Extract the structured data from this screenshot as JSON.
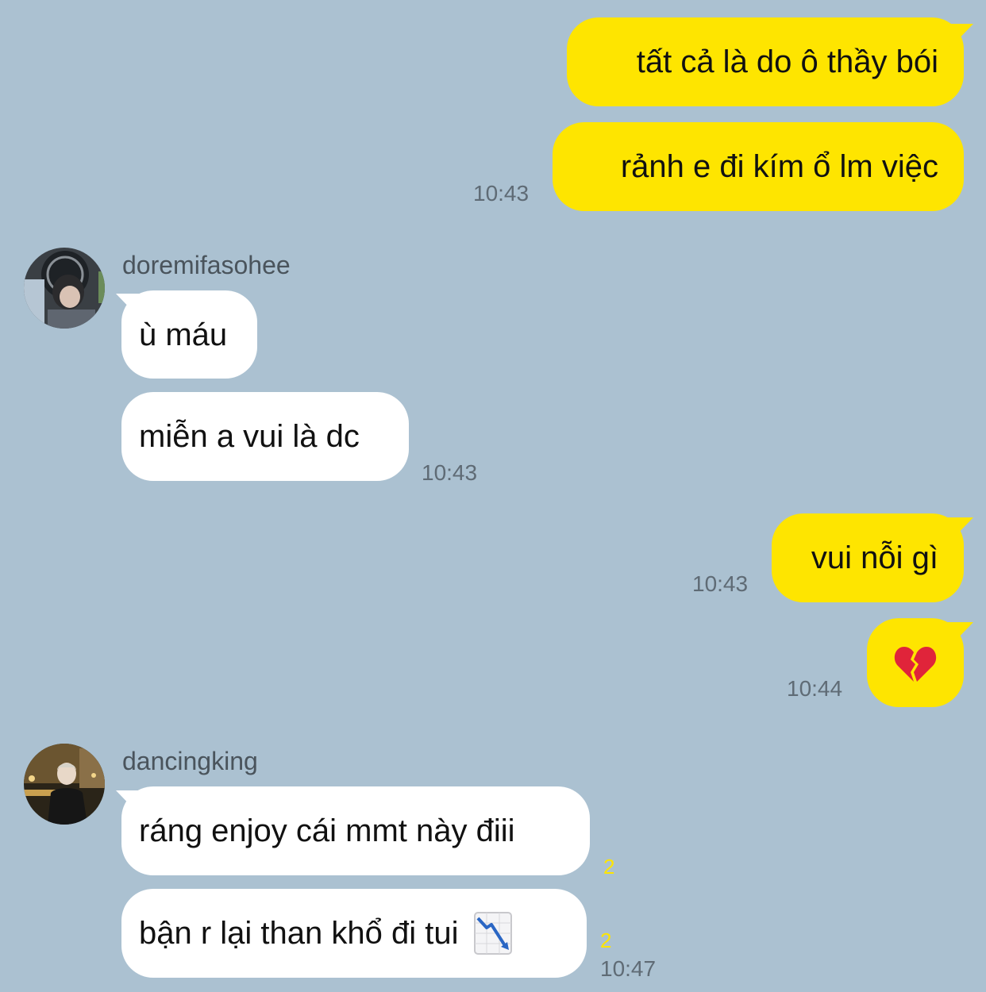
{
  "background_color": "#abc1d1",
  "outgoing_bubble_color": "#fee500",
  "incoming_bubble_color": "#ffffff",
  "messages": [
    {
      "direction": "out",
      "text": "tất cả là do ô thầy bói"
    },
    {
      "direction": "out",
      "text": "rảnh e đi kím ổ lm việc",
      "time": "10:43"
    },
    {
      "direction": "in",
      "sender": "doremifasohee",
      "avatar": "avatar-photo-boy-with-headphones",
      "text": "ù máu"
    },
    {
      "direction": "in",
      "text": "miễn a vui là dc",
      "time": "10:43"
    },
    {
      "direction": "out",
      "text": "vui nỗi gì",
      "time": "10:43"
    },
    {
      "direction": "out",
      "emoji": "broken-heart-icon",
      "time": "10:44"
    },
    {
      "direction": "in",
      "sender": "dancingking",
      "avatar": "avatar-photo-man-street-night",
      "text": "ráng enjoy cái mmt này điii",
      "unread": "2"
    },
    {
      "direction": "in",
      "text": "bận r lại than khổ đi tui",
      "emoji": "chart-decreasing-icon",
      "unread": "2",
      "time": "10:47"
    }
  ]
}
